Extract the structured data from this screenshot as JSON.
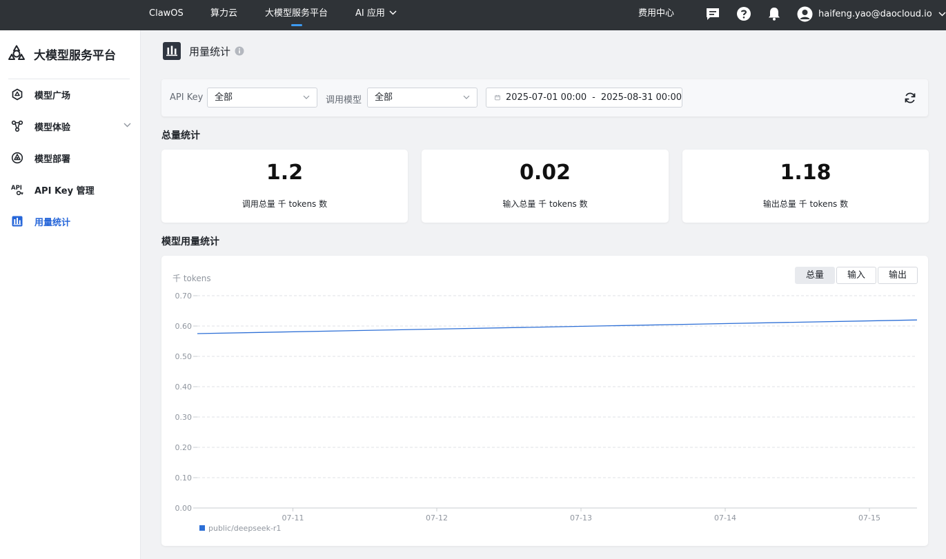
{
  "topbar": {
    "nav": [
      {
        "label": "ClawOS",
        "active": false
      },
      {
        "label": "算力云",
        "active": false
      },
      {
        "label": "大模型服务平台",
        "active": true
      },
      {
        "label": "AI 应用",
        "active": false,
        "dropdown": true
      }
    ],
    "billing": "费用中心",
    "icons": [
      "message-icon",
      "help-icon",
      "bell-icon"
    ],
    "user": {
      "email": "haifeng.yao@daocloud.io",
      "icon": "user-avatar-icon"
    }
  },
  "sidebar": {
    "brand": "大模型服务平台",
    "items": [
      {
        "label": "模型广场",
        "icon": "hexagon-icon",
        "active": false
      },
      {
        "label": "模型体验",
        "icon": "model-experience-icon",
        "active": false,
        "expandable": true
      },
      {
        "label": "模型部署",
        "icon": "deploy-icon",
        "active": false
      },
      {
        "label": "API Key 管理",
        "icon": "api-key-icon",
        "active": false
      },
      {
        "label": "用量统计",
        "icon": "bar-chart-icon",
        "active": true
      }
    ]
  },
  "page": {
    "title": "用量统计",
    "icon": "bar-chart-icon"
  },
  "filters": {
    "api_key_label": "API Key",
    "api_key_value": "全部",
    "model_label": "调用模型",
    "model_value": "全部",
    "date_start": "2025-07-01 00:00",
    "date_separator": "-",
    "date_end": "2025-08-31 00:00"
  },
  "totals": {
    "section_title": "总量统计",
    "cards": [
      {
        "value": "1.2",
        "caption": "调用总量 千 tokens 数"
      },
      {
        "value": "0.02",
        "caption": "输入总量 千 tokens 数"
      },
      {
        "value": "1.18",
        "caption": "输出总量 千 tokens 数"
      }
    ]
  },
  "model_usage": {
    "section_title": "模型用量统计",
    "tabs": [
      {
        "label": "总量",
        "active": true
      },
      {
        "label": "输入",
        "active": false
      },
      {
        "label": "输出",
        "active": false
      }
    ]
  },
  "colors": {
    "accent": "#2666d9",
    "line": "#2d6fd6",
    "topbar": "#2f3337"
  },
  "chart_data": {
    "type": "line",
    "ylabel": "千 tokens",
    "ylim": [
      0,
      0.7
    ],
    "yticks": [
      "0.00",
      "0.10",
      "0.20",
      "0.30",
      "0.40",
      "0.50",
      "0.60",
      "0.70"
    ],
    "x": [
      "07-11",
      "07-12",
      "07-13",
      "07-14",
      "07-15"
    ],
    "x_start": "07-10",
    "x_end": "07-15",
    "series": [
      {
        "name": "public/deepseek-r1",
        "color": "#2d6fd6",
        "start": 0.575,
        "end": 0.62
      }
    ],
    "grid": true,
    "legend": "bottom-left"
  }
}
